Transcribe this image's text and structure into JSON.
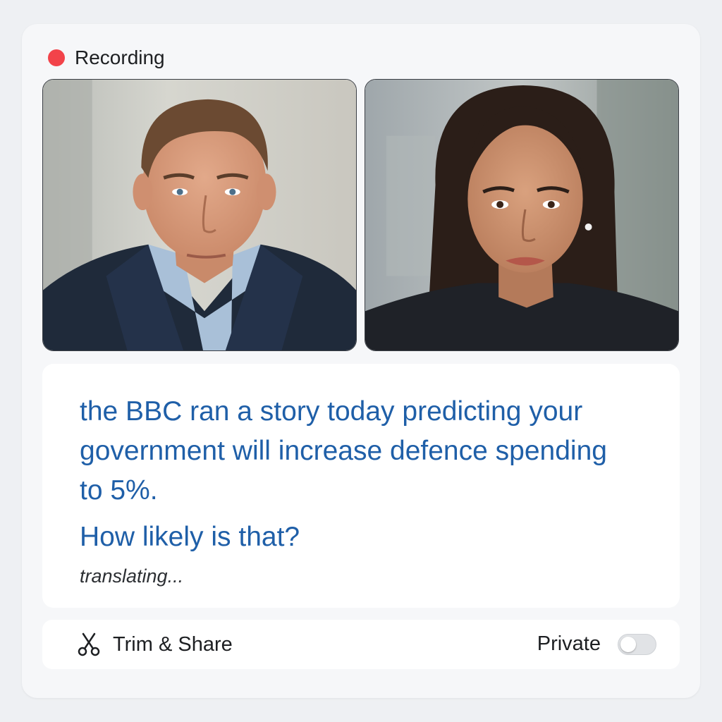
{
  "recording": {
    "label": "Recording",
    "indicator_color": "#f2434a"
  },
  "participants": [
    {
      "avatar": "man-in-navy-suit"
    },
    {
      "avatar": "woman-dark-hair"
    }
  ],
  "captions": {
    "text": "the BBC ran a story today predicting your government will increase defence spending to 5%.",
    "question": "How likely is that?",
    "status": "translating...",
    "color": "#1f5fa8"
  },
  "actions": {
    "trim_share_label": "Trim & Share",
    "trim_icon": "scissors-icon",
    "private_label": "Private",
    "private_enabled": false
  }
}
